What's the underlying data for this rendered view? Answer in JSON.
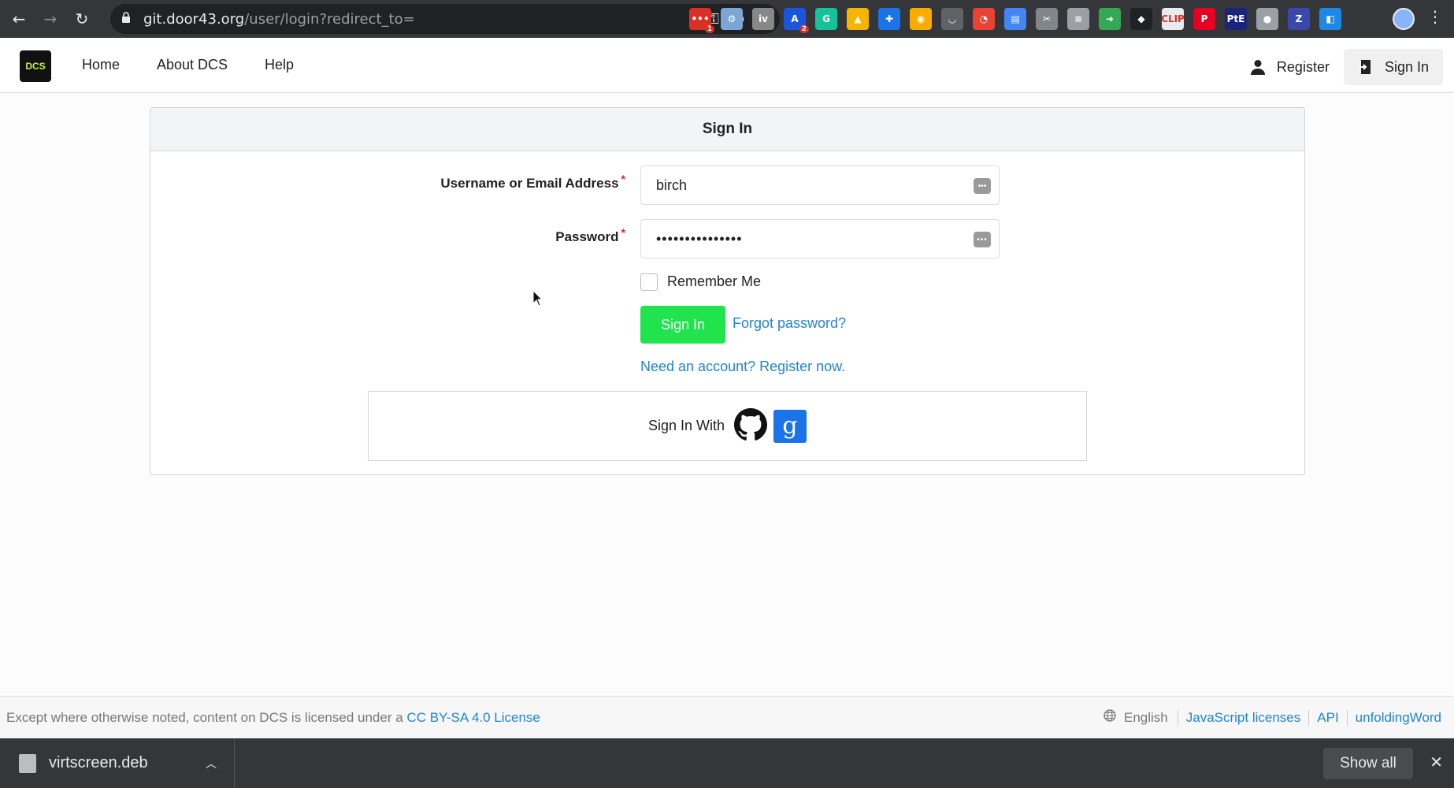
{
  "browser": {
    "url_host": "git.door43.org",
    "url_path": "/user/login?redirect_to=",
    "extensions": [
      {
        "name": "ext-calendar-icon",
        "color": "#d93025",
        "glyph": "•••",
        "badge": "1"
      },
      {
        "name": "ext-gear-icon",
        "color": "#7aa7d6",
        "glyph": "⚙",
        "badge": ""
      },
      {
        "name": "ext-iv-icon",
        "color": "#888888",
        "glyph": "iv",
        "badge": ""
      },
      {
        "name": "ext-a-icon",
        "color": "#1a56db",
        "glyph": "A",
        "badge": "2"
      },
      {
        "name": "ext-grammarly-icon",
        "color": "#15c39a",
        "glyph": "G",
        "badge": ""
      },
      {
        "name": "ext-drive-icon",
        "color": "#f4b400",
        "glyph": "▲",
        "badge": ""
      },
      {
        "name": "ext-plus-icon",
        "color": "#1a73e8",
        "glyph": "✚",
        "badge": ""
      },
      {
        "name": "ext-compass-icon",
        "color": "#f9ab00",
        "glyph": "◉",
        "badge": ""
      },
      {
        "name": "ext-pocket-icon",
        "color": "#5f6368",
        "glyph": "◡",
        "badge": ""
      },
      {
        "name": "ext-color-icon",
        "color": "#e94235",
        "glyph": "◔",
        "badge": ""
      },
      {
        "name": "ext-doc-icon",
        "color": "#4285f4",
        "glyph": "▤",
        "badge": ""
      },
      {
        "name": "ext-snip-icon",
        "color": "#80868b",
        "glyph": "✂",
        "badge": ""
      },
      {
        "name": "ext-stack-icon",
        "color": "#9aa0a6",
        "glyph": "≡",
        "badge": ""
      },
      {
        "name": "ext-arrow-icon",
        "color": "#34a853",
        "glyph": "➜",
        "badge": ""
      },
      {
        "name": "ext-cat-icon",
        "color": "#202124",
        "glyph": "◆",
        "badge": ""
      },
      {
        "name": "ext-clip-icon",
        "color": "#e8eaed",
        "glyph": "CLIP",
        "badge": ""
      },
      {
        "name": "ext-pinterest-icon",
        "color": "#e60023",
        "glyph": "P",
        "badge": ""
      },
      {
        "name": "ext-pte-icon",
        "color": "#1a237e",
        "glyph": "PtE",
        "badge": ""
      },
      {
        "name": "ext-circle-icon",
        "color": "#9aa0a6",
        "glyph": "●",
        "badge": ""
      },
      {
        "name": "ext-z-icon",
        "color": "#3949ab",
        "glyph": "Z",
        "badge": ""
      },
      {
        "name": "ext-bookmark-icon",
        "color": "#1e88e5",
        "glyph": "◧",
        "badge": ""
      }
    ]
  },
  "header": {
    "logo_text": "DCS",
    "nav": [
      "Home",
      "About DCS",
      "Help"
    ],
    "register_label": "Register",
    "signin_label": "Sign In"
  },
  "form": {
    "title": "Sign In",
    "username_label": "Username or Email Address",
    "username_value": "birch",
    "password_label": "Password",
    "password_value": "•••••••••••••••",
    "required_mark": "*",
    "remember_label": "Remember Me",
    "submit_label": "Sign In",
    "forgot_label": "Forgot password?",
    "register_link": "Need an account? Register now.",
    "oauth_label": "Sign In With",
    "oauth_google_glyph": "g"
  },
  "footer": {
    "license_text": "Except where otherwise noted, content on DCS is licensed under a",
    "license_link": "CC BY-SA 4.0 License",
    "language": "English",
    "links": [
      "JavaScript licenses",
      "API",
      "unfoldingWord"
    ]
  },
  "downloads": {
    "file_name": "virtscreen.deb",
    "show_all_label": "Show all"
  }
}
